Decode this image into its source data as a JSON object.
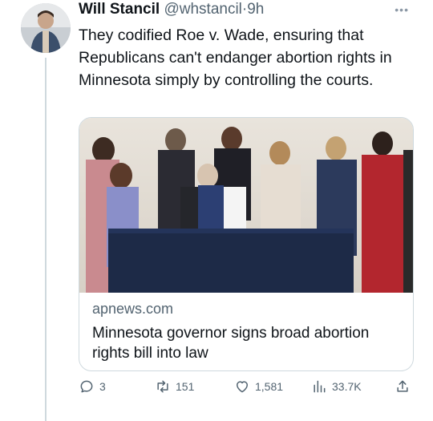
{
  "tweet": {
    "author_name": "Will Stancil",
    "author_handle": "@whstancil",
    "separator": "·",
    "time": "9h",
    "more_label": "•••",
    "text": "They codified Roe v. Wade, ensuring that Republicans can't endanger abortion rights in Minnesota simply by controlling the courts."
  },
  "link_card": {
    "domain": "apnews.com",
    "title": "Minnesota governor signs broad abortion rights bill into law"
  },
  "actions": {
    "replies": "3",
    "retweets": "151",
    "likes": "1,581",
    "views": "33.7K"
  },
  "icons": {
    "reply": "reply-icon",
    "retweet": "retweet-icon",
    "like": "heart-icon",
    "views": "views-icon",
    "share": "share-icon"
  },
  "colors": {
    "text_primary": "#0f1419",
    "text_secondary": "#536471",
    "border": "#cfd9de"
  }
}
